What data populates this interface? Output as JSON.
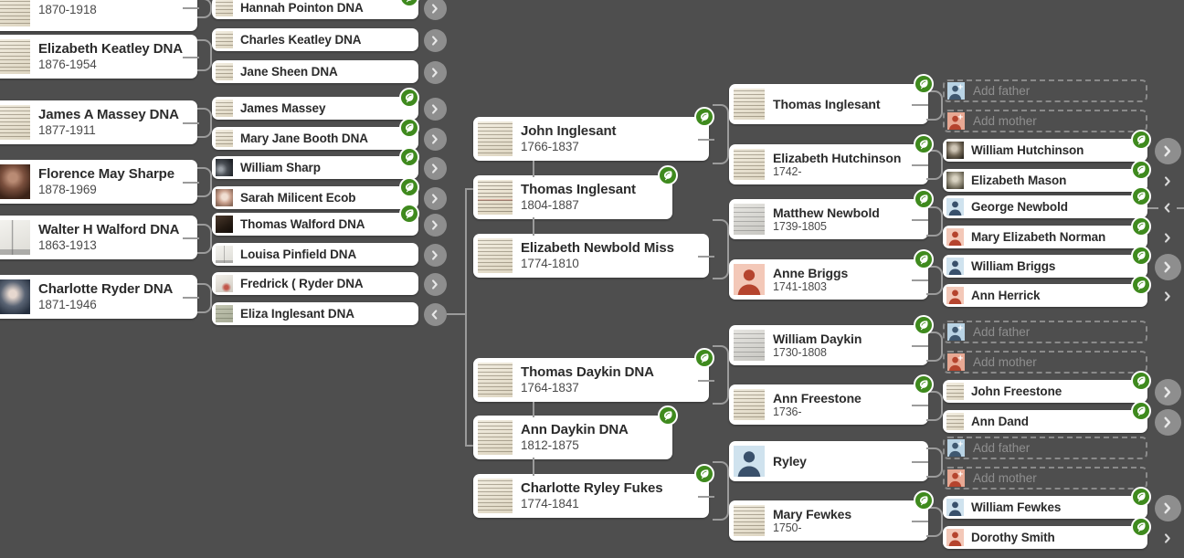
{
  "app": {
    "view": "pedigree-tree",
    "background_color": "#4e4e4e",
    "card_color": "#ffffff",
    "hint_color": "#3f8a1e",
    "connector_color": "#9b9b9b"
  },
  "labels": {
    "add_father": "Add father",
    "add_mother": "Add mother"
  },
  "columns": {
    "col1": {
      "name": "great-grandparents-column",
      "people": [
        {
          "name": "",
          "dates": "1870-1918",
          "thumb": "document",
          "clipped_top": true
        },
        {
          "name": "Elizabeth Keatley DNA",
          "dates": "1876-1954",
          "thumb": "document"
        },
        {
          "name": "James A Massey DNA",
          "dates": "1877-1911",
          "thumb": "document"
        },
        {
          "name": "Florence May Sharpe",
          "dates": "1878-1969",
          "thumb": "photo-woman"
        },
        {
          "name": "Walter H Walford DNA",
          "dates": "1863-1913",
          "thumb": "photo-building"
        },
        {
          "name": "Charlotte Ryder DNA",
          "dates": "1871-1946",
          "thumb": "photo-woman-hat"
        }
      ]
    },
    "col2": {
      "name": "second-generation-column",
      "people": [
        {
          "name": "Hannah Pointon DNA",
          "thumb": "document",
          "hint": true,
          "chevron": "right-filled"
        },
        {
          "name": "Charles Keatley DNA",
          "thumb": "document",
          "hint": false,
          "chevron": "right-filled"
        },
        {
          "name": "Jane Sheen DNA",
          "thumb": "document",
          "hint": false,
          "chevron": "right-filled"
        },
        {
          "name": "James Massey",
          "thumb": "document",
          "hint": true,
          "chevron": "right-filled"
        },
        {
          "name": "Mary Jane Booth DNA",
          "thumb": "document",
          "hint": true,
          "chevron": "right-filled"
        },
        {
          "name": "William Sharp",
          "thumb": "photo-group",
          "hint": true,
          "chevron": "right-filled"
        },
        {
          "name": "Sarah Milicent Ecob",
          "thumb": "photo-woman-face",
          "hint": true,
          "chevron": "right-filled"
        },
        {
          "name": "Thomas Walford DNA",
          "thumb": "photo-dark",
          "hint": true,
          "chevron": "right-filled"
        },
        {
          "name": "Louisa Pinfield DNA",
          "thumb": "photo-building",
          "hint": false,
          "chevron": "right-filled"
        },
        {
          "name": "Fredrick ( Ryder DNA",
          "thumb": "photo-interior",
          "hint": false,
          "chevron": "right-filled"
        },
        {
          "name": "Eliza Inglesant DNA",
          "thumb": "document-green",
          "hint": false,
          "chevron": "left-filled"
        }
      ]
    },
    "col3": {
      "name": "focus-lineage-column",
      "people": [
        {
          "name": "John Inglesant",
          "dates": "1766-1837",
          "thumb": "document",
          "hint": true
        },
        {
          "name": "Thomas Inglesant",
          "dates": "1804-1887",
          "thumb": "document-red",
          "hint": true,
          "focus": true
        },
        {
          "name": "Elizabeth Newbold Miss",
          "dates": "1774-1810",
          "thumb": "document",
          "hint": false
        },
        {
          "name": "Thomas Daykin DNA",
          "dates": "1764-1837",
          "thumb": "document",
          "hint": true
        },
        {
          "name": "Ann Daykin DNA",
          "dates": "1812-1875",
          "thumb": "document",
          "hint": true,
          "focus": true
        },
        {
          "name": "Charlotte Ryley Fukes",
          "dates": "1774-1841",
          "thumb": "document",
          "hint": true
        }
      ]
    },
    "col4": {
      "name": "grandparents-column",
      "people": [
        {
          "name": "Thomas Inglesant",
          "dates": "",
          "thumb": "document",
          "hint": true
        },
        {
          "name": "Elizabeth Hutchinson",
          "dates": "1742-",
          "thumb": "document",
          "hint": true
        },
        {
          "name": "Matthew Newbold",
          "dates": "1739-1805",
          "thumb": "document-grey",
          "hint": true
        },
        {
          "name": "Anne Briggs",
          "dates": "1741-1803",
          "thumb": "silhouette-female",
          "hint": true
        },
        {
          "name": "William Daykin",
          "dates": "1730-1808",
          "thumb": "document-grey",
          "hint": true
        },
        {
          "name": "Ann Freestone",
          "dates": "1736-",
          "thumb": "document",
          "hint": true
        },
        {
          "name": "Ryley",
          "dates": "",
          "thumb": "silhouette-male",
          "hint": false
        },
        {
          "name": "Mary Fewkes",
          "dates": "1750-",
          "thumb": "document",
          "hint": true
        }
      ]
    },
    "col5": {
      "name": "great-grandparents-right-column",
      "entries": [
        {
          "type": "add",
          "role": "father",
          "label": "Add father"
        },
        {
          "type": "add",
          "role": "mother",
          "label": "Add mother"
        },
        {
          "type": "person",
          "name": "William Hutchinson",
          "thumb": "photo-small",
          "hint": true,
          "chevron": "right-filled"
        },
        {
          "type": "person",
          "name": "Elizabeth Mason",
          "thumb": "photo-small2",
          "hint": true,
          "chevron": "right-plain"
        },
        {
          "type": "person",
          "name": "George Newbold",
          "thumb": "silhouette-male",
          "hint": true,
          "chevron": "left-plain"
        },
        {
          "type": "person",
          "name": "Mary Elizabeth Norman",
          "thumb": "silhouette-female",
          "hint": true,
          "chevron": "right-plain"
        },
        {
          "type": "person",
          "name": "William Briggs",
          "thumb": "silhouette-male",
          "hint": true,
          "chevron": "right-filled"
        },
        {
          "type": "person",
          "name": "Ann Herrick",
          "thumb": "silhouette-female",
          "hint": true,
          "chevron": "right-plain"
        },
        {
          "type": "add",
          "role": "father",
          "label": "Add father"
        },
        {
          "type": "add",
          "role": "mother",
          "label": "Add mother"
        },
        {
          "type": "person",
          "name": "John Freestone",
          "thumb": "document",
          "hint": true,
          "chevron": "right-filled"
        },
        {
          "type": "person",
          "name": "Ann Dand",
          "thumb": "document",
          "hint": true,
          "chevron": "right-filled"
        },
        {
          "type": "add",
          "role": "father",
          "label": "Add father"
        },
        {
          "type": "add",
          "role": "mother",
          "label": "Add mother"
        },
        {
          "type": "person",
          "name": "William Fewkes",
          "thumb": "silhouette-male",
          "hint": true,
          "chevron": "right-filled"
        },
        {
          "type": "person",
          "name": "Dorothy Smith",
          "thumb": "silhouette-female",
          "hint": true,
          "chevron": "right-plain"
        }
      ]
    }
  }
}
